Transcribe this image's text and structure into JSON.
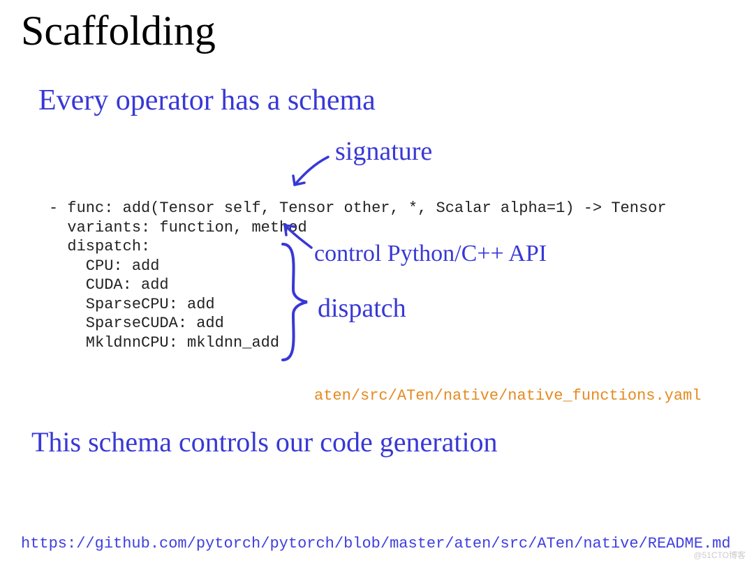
{
  "title": "Scaffolding",
  "headline": "Every operator has a schema",
  "annotations": {
    "signature": "signature",
    "control": "control Python/C++ API",
    "dispatch": "dispatch"
  },
  "code": "- func: add(Tensor self, Tensor other, *, Scalar alpha=1) -> Tensor\n  variants: function, method\n  dispatch:\n    CPU: add\n    CUDA: add\n    SparseCPU: add\n    SparseCUDA: add\n    MkldnnCPU: mkldnn_add",
  "file_path": "aten/src/ATen/native/native_functions.yaml",
  "footer_note": "This schema controls our code generation",
  "github_url": "https://github.com/pytorch/pytorch/blob/master/aten/src/ATen/native/README.md",
  "watermark": "@51CTO博客"
}
